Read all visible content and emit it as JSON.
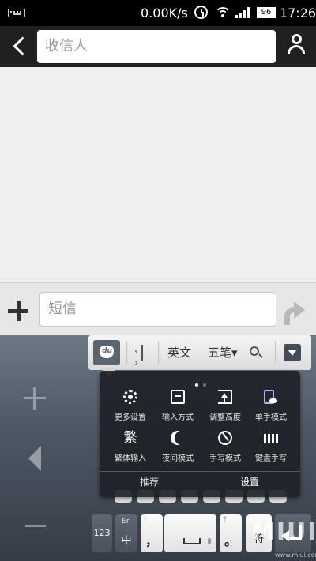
{
  "statusbar": {
    "net_speed": "0.00K/s",
    "battery": "96",
    "time": "17:26"
  },
  "header": {
    "recipient_placeholder": "收信人"
  },
  "compose": {
    "sms_placeholder": "短信"
  },
  "keyboard": {
    "toolbar": {
      "english": "英文",
      "wubi": "五笔▾"
    },
    "popup": {
      "items": [
        {
          "label": "更多设置",
          "icon": "gear-icon"
        },
        {
          "label": "输入方式",
          "icon": "input-method-icon"
        },
        {
          "label": "调整高度",
          "icon": "height-icon"
        },
        {
          "label": "单手模式",
          "icon": "one-hand-icon"
        },
        {
          "label": "繁体输入",
          "icon": "traditional-icon"
        },
        {
          "label": "夜间模式",
          "icon": "moon-icon"
        },
        {
          "label": "手写模式",
          "icon": "handwriting-icon"
        },
        {
          "label": "键盘手写",
          "icon": "keyboard-handwriting-icon"
        }
      ],
      "tabs": [
        {
          "label": "推荐"
        },
        {
          "label": "设置"
        }
      ]
    },
    "keys": {
      "num": "123",
      "en_small": "En",
      "zh": "中",
      "comma_small": "!",
      "comma": "，",
      "period_small": "?",
      "period": "。",
      "symbol": "符"
    },
    "watermark": "MIUI",
    "watermark_url": "www.miui.com"
  }
}
